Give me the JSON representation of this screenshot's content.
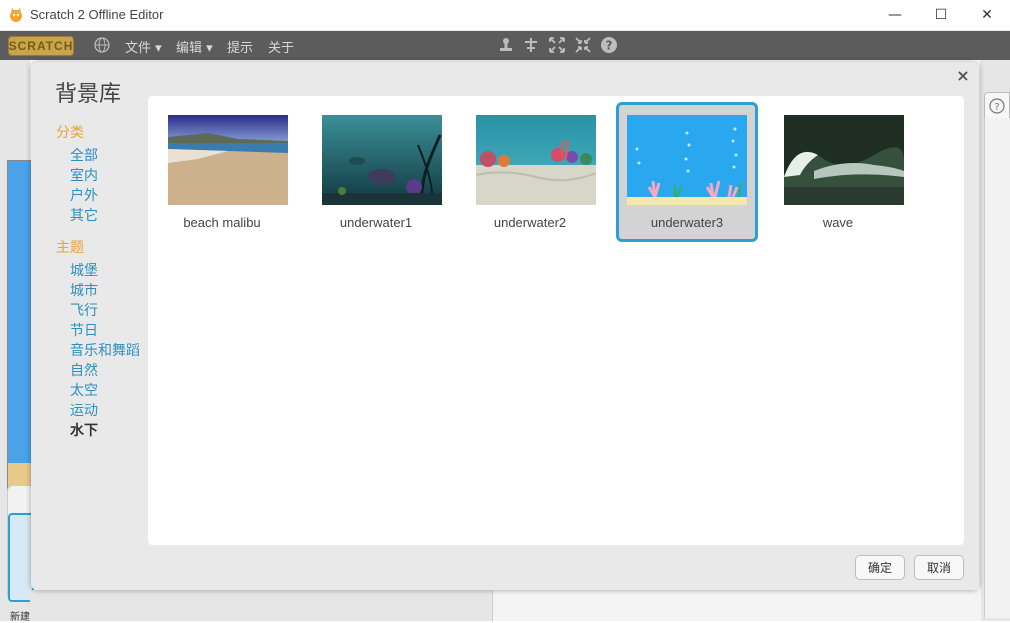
{
  "window": {
    "title": "Scratch 2 Offline Editor",
    "minimize_glyph": "—",
    "maximize_glyph": "☐",
    "close_glyph": "✕"
  },
  "menubar": {
    "logo_text": "SCRATCH",
    "items": [
      "文件",
      "编辑",
      "提示",
      "关于"
    ],
    "dropdown_glyph": "▾",
    "tools": [
      "stamp-icon",
      "cut-icon",
      "grow-icon",
      "shrink-icon",
      "help-icon"
    ]
  },
  "background_app": {
    "new_backdrop_label": "新建背景",
    "help_glyph": "?"
  },
  "dialog": {
    "title": "背景库",
    "close_glyph": "×",
    "category_heading": "分类",
    "categories": [
      "全部",
      "室内",
      "户外",
      "其它"
    ],
    "theme_heading": "主题",
    "themes": [
      "城堡",
      "城市",
      "飞行",
      "节日",
      "音乐和舞蹈",
      "自然",
      "太空",
      "运动",
      "水下"
    ],
    "selected_theme": "水下",
    "backdrops": [
      {
        "name": "beach malibu"
      },
      {
        "name": "underwater1"
      },
      {
        "name": "underwater2"
      },
      {
        "name": "underwater3"
      },
      {
        "name": "wave"
      }
    ],
    "selected_backdrop": "underwater3",
    "ok_label": "确定",
    "cancel_label": "取消"
  },
  "colors": {
    "accent": "#2e9fd3",
    "category_heading": "#e8a23a",
    "link": "#2e8fbf",
    "menubar": "#5c5c5c"
  }
}
